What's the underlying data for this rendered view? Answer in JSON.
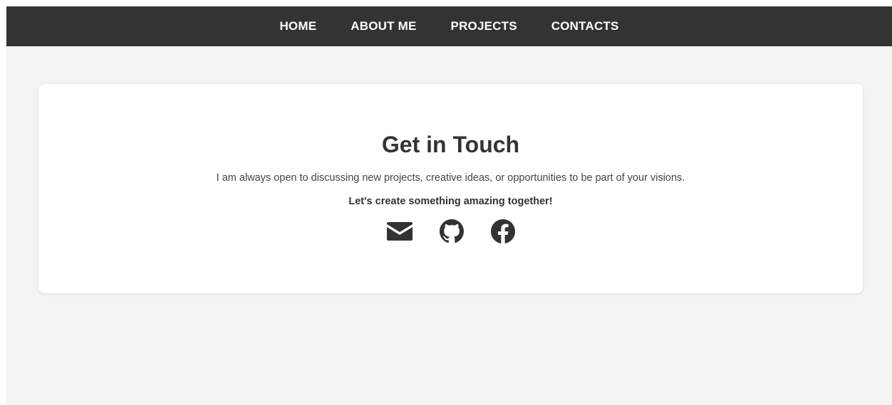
{
  "nav": {
    "items": [
      {
        "label": "HOME"
      },
      {
        "label": "ABOUT ME"
      },
      {
        "label": "PROJECTS"
      },
      {
        "label": "CONTACTS"
      }
    ]
  },
  "contact": {
    "title": "Get in Touch",
    "description": "I am always open to discussing new projects, creative ideas, or opportunities to be part of your visions.",
    "cta": "Let's create something amazing together!",
    "socials": [
      {
        "icon": "envelope-icon"
      },
      {
        "icon": "github-icon"
      },
      {
        "icon": "facebook-icon"
      }
    ]
  },
  "colors": {
    "nav_background": "#333333",
    "page_background": "#f3f3f3",
    "card_background": "#ffffff",
    "text": "#333333"
  }
}
